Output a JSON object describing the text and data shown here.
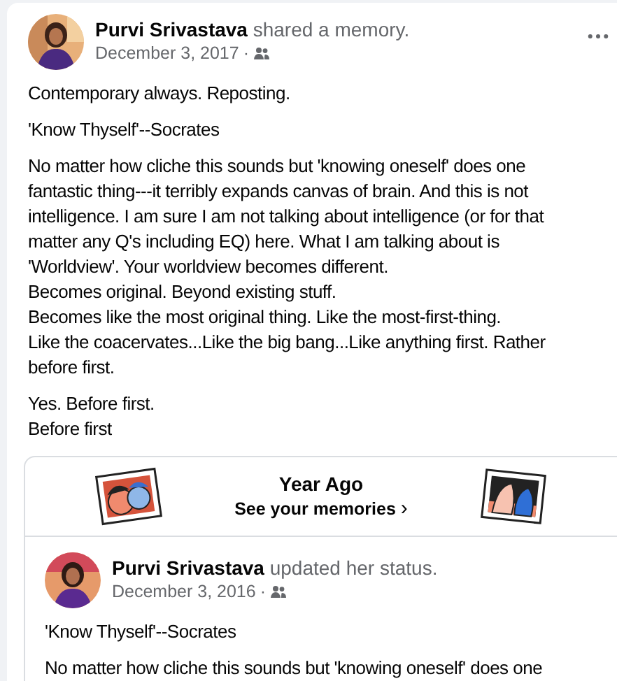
{
  "post": {
    "avatar": {
      "kind": "picture"
    },
    "author": "Purvi Srivastava",
    "action": "shared a memory.",
    "date": "December 3, 2017",
    "separator": "·",
    "paragraphs": [
      [
        "Contemporary always. Reposting."
      ],
      [
        "'Know Thyself'--Socrates"
      ],
      [
        "No matter how cliche this sounds but 'knowing oneself' does one",
        "fantastic thing---it terribly expands canvas of brain. And this is not",
        "intelligence. I am sure I am not talking about intelligence (or for that",
        "matter any Q's including EQ) here. What I am talking about is",
        "'Worldview'. Your worldview becomes different.",
        "Becomes original. Beyond existing stuff.",
        "Becomes like the most original thing. Like the most-first-thing.",
        "Like the coacervates...Like the big bang...Like anything first. Rather",
        "before first."
      ],
      [
        "Yes. Before first.",
        "Before first"
      ]
    ]
  },
  "memory": {
    "title": "Year Ago",
    "link": "See your memories",
    "chevron": "›",
    "post": {
      "avatar": {
        "kind": "picture"
      },
      "author": "Purvi Srivastava",
      "action": "updated her status.",
      "date": "December 3, 2016",
      "separator": "·",
      "paragraphs": [
        [
          "'Know Thyself'--Socrates"
        ],
        [
          "No matter how cliche this sounds but 'knowing oneself' does one"
        ]
      ]
    }
  }
}
